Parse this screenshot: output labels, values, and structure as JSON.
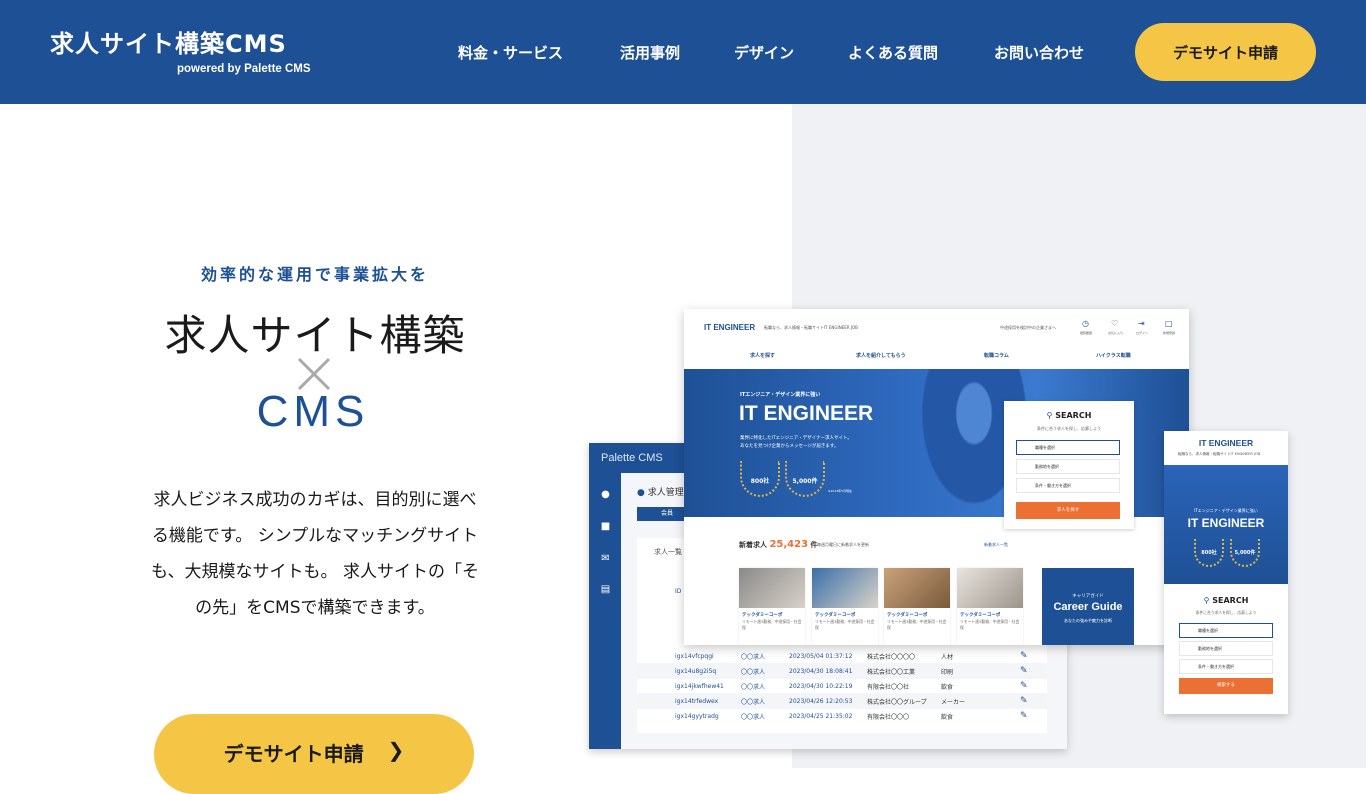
{
  "header": {
    "site_title": "求人サイト構築CMS",
    "subtitle": "powered by Palette CMS",
    "nav": [
      {
        "label": "料金・サービス"
      },
      {
        "label": "活用事例"
      },
      {
        "label": "デザイン"
      },
      {
        "label": "よくある質問"
      },
      {
        "label": "お問い合わせ"
      }
    ],
    "cta_label": "デモサイト申請"
  },
  "colors": {
    "brand": "#1e5095",
    "accent": "#f5c545",
    "orange": "#ec6f34"
  },
  "hero": {
    "tagline": "効率的な運用で事業拡大を",
    "title": "求人サイト構築",
    "times": "×",
    "cms": "CMS",
    "description": "求人ビジネス成功のカギは、目的別に選べる機能です。 シンプルなマッチングサイトも、大規模なサイトも。 求人サイトの「その先」をCMSで構築できます。",
    "cta_label": "デモサイト申請",
    "cta_icon": "chevron-right-icon"
  },
  "cms_mock": {
    "brand": "Palette CMS",
    "page_title": "求人管理",
    "tab": "会員",
    "list_title": "求人一覧",
    "id_header": "ID",
    "rows": [
      {
        "id": "igx14vfcpqgi",
        "type": "〇〇求人",
        "date": "2023/05/04 01:37:12",
        "company": "株式会社〇〇〇〇",
        "industry": "人材"
      },
      {
        "id": "igx14u8g2i5q",
        "type": "〇〇求人",
        "date": "2023/04/30 18:08:41",
        "company": "株式会社〇〇工業",
        "industry": "印刷"
      },
      {
        "id": "igx14jkwfhew41",
        "type": "〇〇求人",
        "date": "2023/04/30 10:22:19",
        "company": "有限会社〇〇社",
        "industry": "飲食"
      },
      {
        "id": "igx14trfedwex",
        "type": "〇〇求人",
        "date": "2023/04/26 12:20:53",
        "company": "株式会社〇〇グループ",
        "industry": "メーカー"
      },
      {
        "id": "igx14gyytradg",
        "type": "〇〇求人",
        "date": "2023/04/25 21:35:02",
        "company": "有限会社〇〇〇",
        "industry": "飲食"
      }
    ]
  },
  "desktop_mock": {
    "logo": "IT ENGINEER",
    "tagline": "転職なら、求人情報・転職サイトIT ENGINEER JOB",
    "header_note": "中途採用を検討中の企業さまへ",
    "icons": [
      {
        "icon": "clock-icon",
        "label": "閲覧履歴"
      },
      {
        "icon": "heart-icon",
        "label": "お気に入り"
      },
      {
        "icon": "login-icon",
        "label": "ログイン"
      },
      {
        "icon": "document-icon",
        "label": "新規登録"
      }
    ],
    "nav": [
      "求人を探す",
      "求人を紹介してもらう",
      "転職コラム",
      "ハイクラス転職"
    ],
    "hero_small": "ITエンジニア・デザイン業界に強い",
    "hero_big": "IT ENGINEER",
    "hero_desc1": "業界に特化したITエンジニア・デザイナー求人サイト。",
    "hero_desc2": "あなたを見つけ企業からメッセージが届きます。",
    "badge1": "800社",
    "badge2": "5,000件",
    "badge_note": "※2023年5月現在",
    "search_title": "SEARCH",
    "search_sub": "条件に合う求人を探し、応募しよう",
    "search_options": [
      "職種を選択",
      "勤務地を選択",
      "条件・働き方を選択"
    ],
    "search_button": "求人を探す",
    "new_jobs_label": "新着求人",
    "new_jobs_count": "25,423",
    "new_jobs_unit": "件",
    "new_jobs_note": "毎週月曜日に新着求人を更新",
    "new_jobs_link": "新着求人一覧",
    "jobs": [
      {
        "title": "テックダミーコーポ",
        "desc": "リモート週3勤務、中途採用・社会保"
      },
      {
        "title": "テックダミーコーポ",
        "desc": "リモート週3勤務、中途採用・社会保"
      },
      {
        "title": "テックダミーコーポ",
        "desc": "リモート週3勤務、中途採用・社会保"
      },
      {
        "title": "テックダミーコーポ",
        "desc": "リモート週3勤務、中途採用・社会保"
      }
    ],
    "career_small": "キャリアガイド",
    "career_big": "Career Guide",
    "career_desc": "あなたの強みや魅力を診断"
  },
  "mobile_mock": {
    "logo": "IT ENGINEER",
    "tagline": "転職なら、求人情報・転職サイトIT ENGINEER JOB",
    "hero_small": "ITエンジニア・デザイン業界に強い",
    "hero_big": "IT ENGINEER",
    "badge1": "800社",
    "badge2": "5,000件",
    "search_title": "SEARCH",
    "search_sub": "条件に合う求人を探し、応募しよう",
    "search_options": [
      "職種を選択",
      "勤務地を選択",
      "条件・働き方を選択"
    ],
    "search_button": "検索する"
  }
}
